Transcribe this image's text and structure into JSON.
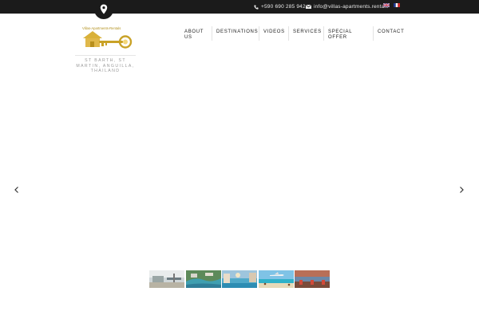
{
  "topbar": {
    "phone": "+590 690 285 942",
    "email": "info@villas-apartments.rentals",
    "icons": [
      "location-pin-icon",
      "phone-icon",
      "envelope-icon"
    ],
    "languages": [
      "english-flag-icon",
      "french-flag-icon"
    ]
  },
  "logo": {
    "icon": "house-key-logo",
    "text": "Villas-Apartments-Rentals"
  },
  "tagline": "ST BARTH, ST MARTIN, ANGUILLA, THAILAND",
  "nav": {
    "items": [
      {
        "label": "ABOUT US"
      },
      {
        "label": "DESTINATIONS"
      },
      {
        "label": "VIDEOS"
      },
      {
        "label": "SERVICES"
      },
      {
        "label": "SPECIAL OFFER"
      },
      {
        "label": "CONTACT"
      }
    ]
  },
  "slider": {
    "prev_icon": "chevron-left-icon",
    "next_icon": "chevron-right-icon",
    "thumbnails": [
      "villa-terrace",
      "coastal-aerial",
      "infinity-pool",
      "beach-airplane",
      "sunset-deck"
    ]
  },
  "colors": {
    "topbar": "#1b1b1b",
    "accent_gold": "#c9a227",
    "text": "#222222",
    "muted": "#9a9a9a"
  }
}
